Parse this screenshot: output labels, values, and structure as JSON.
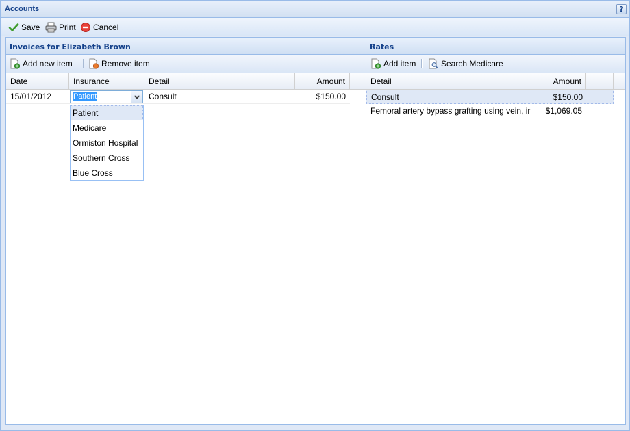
{
  "window": {
    "title": "Accounts",
    "help_label": "?"
  },
  "toolbar": {
    "save_label": "Save",
    "print_label": "Print",
    "cancel_label": "Cancel"
  },
  "invoices": {
    "title": "Invoices for Elizabeth Brown",
    "add_label": "Add new item",
    "remove_label": "Remove item",
    "columns": [
      "Date",
      "Insurance",
      "Detail",
      "Amount"
    ],
    "rows": [
      {
        "date": "15/01/2012",
        "insurance": "Patient",
        "detail": "Consult",
        "amount": "$150.00"
      }
    ],
    "insurance_options": [
      "Patient",
      "Medicare",
      "Ormiston Hospital",
      "Southern Cross",
      "Blue Cross"
    ],
    "selected_option": "Patient"
  },
  "rates": {
    "title": "Rates",
    "add_label": "Add item",
    "search_label": "Search Medicare",
    "columns": [
      "Detail",
      "Amount"
    ],
    "rows": [
      {
        "detail": "Consult",
        "amount": "$150.00"
      },
      {
        "detail": "Femoral artery bypass grafting using vein, ir",
        "amount": "$1,069.05"
      }
    ]
  },
  "colors": {
    "header_text": "#15428b",
    "border": "#99bbe8",
    "selection": "#dfe8f6",
    "highlight": "#3399ff"
  }
}
